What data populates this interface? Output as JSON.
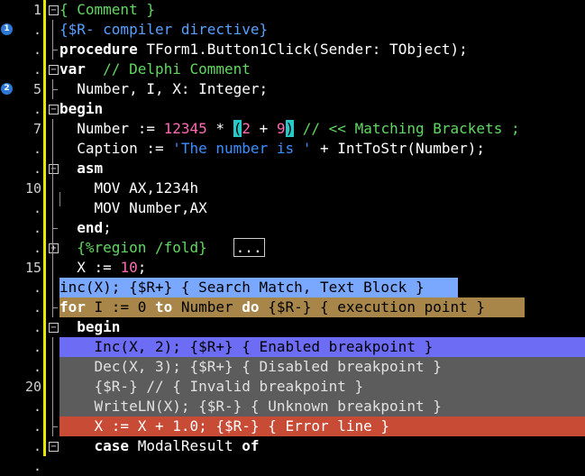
{
  "gutter": {
    "line_numbers": [
      "1",
      ".",
      ".",
      ".",
      "5",
      ".",
      "7",
      ".",
      ".",
      "10",
      ".",
      ".",
      ".",
      "15",
      ".",
      ".",
      ".",
      ".",
      ".",
      "20",
      ".",
      ".",
      ".",
      "."
    ],
    "markers": [
      {
        "label": "1",
        "row": 1
      },
      {
        "label": "2",
        "row": 4
      }
    ]
  },
  "code_lines": [
    {
      "segments": [
        {
          "t": "{ Comment }",
          "c": "cm"
        }
      ]
    },
    {
      "segments": [
        {
          "t": "{$R- compiler directive}",
          "c": "dir"
        }
      ]
    },
    {
      "segments": [
        {
          "t": "procedure",
          "c": "kw"
        },
        {
          "t": " TForm1.Button1Click(Sender: TObject);",
          "c": ""
        }
      ]
    },
    {
      "segments": [
        {
          "t": "var",
          "c": "kw"
        },
        {
          "t": "  // Delphi Comment",
          "c": "cm"
        }
      ]
    },
    {
      "segments": [
        {
          "t": "  Number, I, X: Integer;",
          "c": ""
        }
      ]
    },
    {
      "segments": [
        {
          "t": "begin",
          "c": "kw"
        }
      ]
    },
    {
      "segments": [
        {
          "t": "  Number := ",
          "c": ""
        },
        {
          "t": "12345",
          "c": "num"
        },
        {
          "t": " * ",
          "c": ""
        },
        {
          "t": "(",
          "c": "bracket"
        },
        {
          "t": "2",
          "c": "num"
        },
        {
          "t": " + ",
          "c": ""
        },
        {
          "t": "9",
          "c": "num"
        },
        {
          "t": ")",
          "c": "bracket"
        },
        {
          "t": " // << Matching Brackets ;",
          "c": "cm"
        }
      ]
    },
    {
      "segments": [
        {
          "t": "  Caption := ",
          "c": ""
        },
        {
          "t": "'The number is '",
          "c": "str"
        },
        {
          "t": " + IntToStr(Number);",
          "c": ""
        }
      ]
    },
    {
      "segments": [
        {
          "t": "  ",
          "c": ""
        },
        {
          "t": "asm",
          "c": "kw"
        }
      ]
    },
    {
      "segments": [
        {
          "t": "    MOV AX,1234h",
          "c": ""
        }
      ]
    },
    {
      "segments": [
        {
          "t": "    MOV Number,AX",
          "c": ""
        }
      ]
    },
    {
      "segments": [
        {
          "t": "  ",
          "c": ""
        },
        {
          "t": "end",
          "c": "kw"
        },
        {
          "t": ";",
          "c": ""
        }
      ]
    },
    {
      "segments": [
        {
          "t": "  {%region /fold}",
          "c": "cm"
        },
        {
          "t": "   ",
          "c": ""
        },
        {
          "t": "...",
          "c": "fold-box"
        }
      ]
    },
    {
      "segments": [
        {
          "t": "  X := ",
          "c": ""
        },
        {
          "t": "10",
          "c": "num"
        },
        {
          "t": ";",
          "c": ""
        }
      ]
    },
    {
      "segments": [
        {
          "t": "inc(X); {$R+} { Search Match, Text Block }",
          "c": ""
        }
      ]
    },
    {
      "segments": [
        {
          "t": "for",
          "c": "kw"
        },
        {
          "t": " I := 0 ",
          "c": ""
        },
        {
          "t": "to",
          "c": "kw"
        },
        {
          "t": " Number ",
          "c": ""
        },
        {
          "t": "do",
          "c": "kw"
        },
        {
          "t": " {$R-} { execution point }",
          "c": ""
        }
      ]
    },
    {
      "segments": [
        {
          "t": "  ",
          "c": ""
        },
        {
          "t": "begin",
          "c": "kw"
        }
      ]
    },
    {
      "segments": [
        {
          "t": "    Inc(X, 2); {$R+} { Enabled breakpoint }",
          "c": ""
        }
      ]
    },
    {
      "segments": [
        {
          "t": "    Dec(X, 3); {$R+} { Disabled breakpoint }",
          "c": ""
        }
      ]
    },
    {
      "segments": [
        {
          "t": "    {$R-} // { Invalid breakpoint }",
          "c": ""
        }
      ]
    },
    {
      "segments": [
        {
          "t": "    WriteLN(X); {$R-} { Unknown breakpoint }",
          "c": ""
        }
      ]
    },
    {
      "segments": [
        {
          "t": "    X := X + 1.0; {$R-} { Error line }",
          "c": ""
        }
      ]
    },
    {
      "segments": [
        {
          "t": "    ",
          "c": ""
        },
        {
          "t": "case",
          "c": "kw"
        },
        {
          "t": " ModalResult ",
          "c": ""
        },
        {
          "t": "of",
          "c": "kw"
        }
      ]
    }
  ],
  "colors": {
    "search_match": "#7aa8ff",
    "execution_point": "#a8864a",
    "enabled_breakpoint": "#6c6cf4",
    "disabled_breakpoint": "#5c5c5c",
    "error_line": "#c84b36",
    "gutter_bar": "#e8e800",
    "bracket_match": "#27c9c9"
  }
}
